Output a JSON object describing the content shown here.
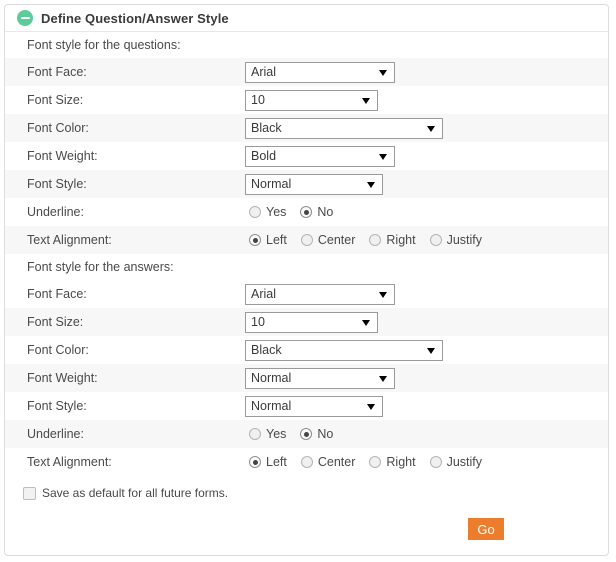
{
  "panel": {
    "title": "Define Question/Answer Style",
    "collapse_icon": "minus-circle-icon",
    "accent_green": "#5ecb9a",
    "accent_orange": "#ec7d2d"
  },
  "sections": [
    {
      "heading": "Font style for the questions:",
      "rows": [
        {
          "label": "Font Face:",
          "type": "select",
          "value": "Arial",
          "width_class": "w-face"
        },
        {
          "label": "Font Size:",
          "type": "select",
          "value": "10",
          "width_class": "w-size"
        },
        {
          "label": "Font Color:",
          "type": "select",
          "value": "Black",
          "width_class": "w-color"
        },
        {
          "label": "Font Weight:",
          "type": "select",
          "value": "Bold",
          "width_class": "w-weight"
        },
        {
          "label": "Font Style:",
          "type": "select",
          "value": "Normal",
          "width_class": "w-style"
        },
        {
          "label": "Underline:",
          "type": "radio",
          "options": [
            "Yes",
            "No"
          ],
          "selected": "No"
        },
        {
          "label": "Text Alignment:",
          "type": "radio",
          "options": [
            "Left",
            "Center",
            "Right",
            "Justify"
          ],
          "selected": "Left"
        }
      ]
    },
    {
      "heading": "Font style for the answers:",
      "rows": [
        {
          "label": "Font Face:",
          "type": "select",
          "value": "Arial",
          "width_class": "w-face"
        },
        {
          "label": "Font Size:",
          "type": "select",
          "value": "10",
          "width_class": "w-size"
        },
        {
          "label": "Font Color:",
          "type": "select",
          "value": "Black",
          "width_class": "w-color"
        },
        {
          "label": "Font Weight:",
          "type": "select",
          "value": "Normal",
          "width_class": "w-weight"
        },
        {
          "label": "Font Style:",
          "type": "select",
          "value": "Normal",
          "width_class": "w-style"
        },
        {
          "label": "Underline:",
          "type": "radio",
          "options": [
            "Yes",
            "No"
          ],
          "selected": "No"
        },
        {
          "label": "Text Alignment:",
          "type": "radio",
          "options": [
            "Left",
            "Center",
            "Right",
            "Justify"
          ],
          "selected": "Left"
        }
      ]
    }
  ],
  "footer": {
    "save_default_label": "Save as default for all future forms.",
    "save_default_checked": false,
    "submit_label": "Go"
  }
}
